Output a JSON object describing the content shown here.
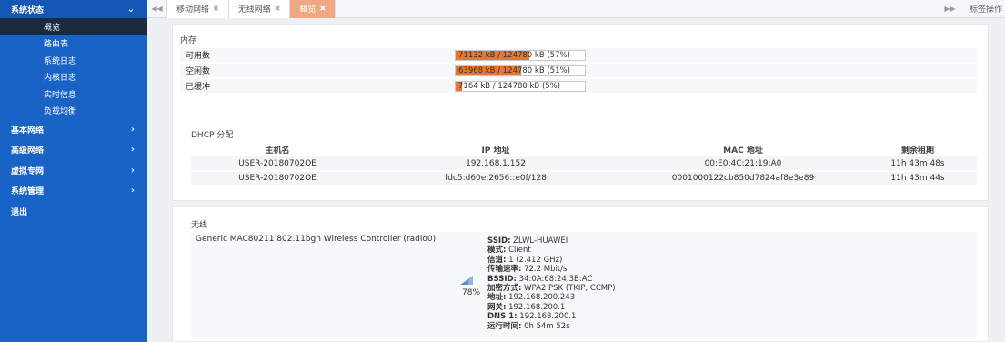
{
  "sidebar": {
    "group_title": "系统状态",
    "group_arrow": "⌄",
    "sub_items": [
      {
        "label": "概览",
        "active": true
      },
      {
        "label": "路由表"
      },
      {
        "label": "系统日志"
      },
      {
        "label": "内核日志"
      },
      {
        "label": "实时信息"
      },
      {
        "label": "负载均衡"
      }
    ],
    "menus": [
      {
        "label": "基本网络",
        "arrow": "›"
      },
      {
        "label": "高级网络",
        "arrow": "›"
      },
      {
        "label": "虚拟专网",
        "arrow": "›"
      },
      {
        "label": "系统管理",
        "arrow": "›"
      },
      {
        "label": "退出",
        "arrow": ""
      }
    ]
  },
  "tabbar": {
    "nav_left": "◀◀",
    "nav_right": "▶▶",
    "tabs": [
      {
        "label": "移动网络",
        "close": "✖"
      },
      {
        "label": "无线网络",
        "close": "✖"
      },
      {
        "label": "概览",
        "close": "✖",
        "active": true
      }
    ],
    "ops_label": "标签操作"
  },
  "memory": {
    "title": "内存",
    "rows": [
      {
        "label": "可用数",
        "text": "71132 kB / 124780 kB (57%)",
        "percent": 57
      },
      {
        "label": "空闲数",
        "text": "63968 kB / 124780 kB (51%)",
        "percent": 51
      },
      {
        "label": "已缓冲",
        "text": "7164 kB / 124780 kB (5%)",
        "percent": 5
      }
    ]
  },
  "dhcp": {
    "title": "DHCP 分配",
    "headers": [
      "主机名",
      "IP 地址",
      "MAC 地址",
      "剩余租期"
    ],
    "rows": [
      [
        "USER-20180702OE",
        "192.168.1.152",
        "00:E0:4C:21:19:A0",
        "11h 43m 48s"
      ],
      [
        "USER-20180702OE",
        "fdc5:d60e:2656::e0f/128",
        "0001000122cb850d7824af8e3e89",
        "11h 43m 44s"
      ]
    ]
  },
  "wireless": {
    "title": "无线",
    "device": "Generic MAC80211 802.11bgn Wireless Controller (radio0)",
    "signal_percent": "78%",
    "info": [
      {
        "k": "SSID:",
        "v": " ZLWL-HUAWEI"
      },
      {
        "k": "模式:",
        "v": " Client"
      },
      {
        "k": "信道:",
        "v": " 1 (2.412 GHz)"
      },
      {
        "k": "传输速率:",
        "v": " 72.2 Mbit/s"
      },
      {
        "k": "BSSID:",
        "v": " 34:0A:68:24:3B:AC"
      },
      {
        "k": "加密方式:",
        "v": " WPA2 PSK (TKIP, CCMP)"
      },
      {
        "k": "地址:",
        "v": " 192.168.200.243"
      },
      {
        "k": "网关:",
        "v": " 192.168.200.1"
      },
      {
        "k": "DNS 1:",
        "v": " 192.168.200.1"
      },
      {
        "k": "运行时间:",
        "v": " 0h 54m 52s"
      }
    ]
  },
  "colors": {
    "sidebar": "#1a63c6",
    "active_sub": "#1b2a3c",
    "bar_fill": "#e8772c",
    "active_tab": "#f0a884"
  }
}
